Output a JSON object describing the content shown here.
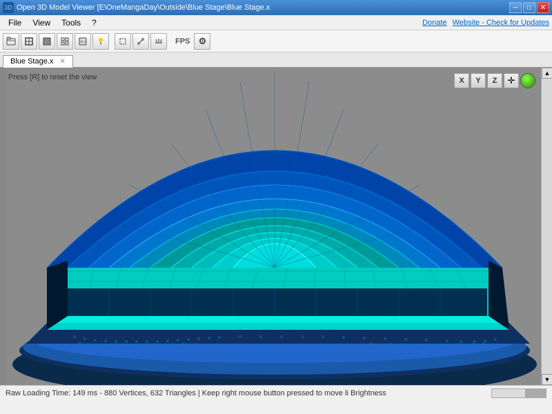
{
  "titlebar": {
    "title": "Open 3D Model Viewer  [E\\OneMangaDay\\Outside\\Blue Stage\\Blue Stage.x",
    "icon": "3D"
  },
  "win_controls": {
    "minimize": "─",
    "maximize": "□",
    "close": "✕"
  },
  "menu": {
    "file": "File",
    "view": "View",
    "tools": "Tools",
    "help": "?",
    "donate": "Donate",
    "website": "Website - Check for Updates"
  },
  "toolbar": {
    "fps_label": "FPS",
    "buttons": [
      "□",
      "▣",
      "⊞",
      "◫",
      "◈",
      "◉",
      "⊡",
      "🔧",
      "◻"
    ]
  },
  "tab": {
    "name": "Blue Stage.x"
  },
  "viewport": {
    "reset_hint": "Press [R] to reset the view",
    "x_axis": "X",
    "y_axis": "Y",
    "z_axis": "Z"
  },
  "statusbar": {
    "text": "Raw Loading Time: 149 ms - 880 Vertices, 632 Triangles  |  Keep right mouse button pressed to move li Brightness"
  }
}
